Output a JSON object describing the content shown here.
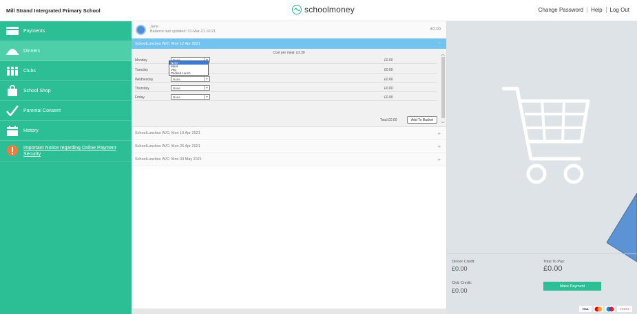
{
  "header": {
    "school_name": "Mill Strand Intergrated Primary School",
    "logo_text": "schoolmoney",
    "links": [
      "Change Password",
      "Help",
      "Log Out"
    ]
  },
  "sidebar": {
    "items": [
      {
        "label": "Payments",
        "icon": "card-icon"
      },
      {
        "label": "Dinners",
        "icon": "dish-icon"
      },
      {
        "label": "Clubs",
        "icon": "people-icon"
      },
      {
        "label": "School Shop",
        "icon": "bag-icon"
      },
      {
        "label": "Parental Consent",
        "icon": "check-icon"
      },
      {
        "label": "History",
        "icon": "calendar-icon"
      },
      {
        "label": "Important Notice regarding Online Payment Security",
        "icon": "alert-icon"
      }
    ]
  },
  "account": {
    "name": "Jane",
    "balance_note": "Balance last updated: 31-Mar-21 10:21",
    "balance": "£0.00"
  },
  "current_week": {
    "title": "SchoolLunches W/C: Mon 12 Apr 2021",
    "cost_per_meal": "Cost per meal: £2.30",
    "days": [
      {
        "name": "Monday",
        "choice": "None",
        "price": "£0.00"
      },
      {
        "name": "Tuesday",
        "choice": "None",
        "price": "£0.00"
      },
      {
        "name": "Wednesday",
        "choice": "None",
        "price": "£0.00"
      },
      {
        "name": "Thursday",
        "choice": "None",
        "price": "£0.00"
      },
      {
        "name": "Friday",
        "choice": "None",
        "price": "£0.00"
      }
    ],
    "dropdown_options": [
      "None",
      "Meat",
      "Veg",
      "Packed Lunch"
    ],
    "total": "Total £0.00",
    "add_button": "Add To Basket"
  },
  "other_weeks": [
    "SchoolLunches W/C: Mon 19 Apr 2021",
    "SchoolLunches W/C: Mon 26 Apr 2021",
    "SchoolLunches W/C: Mon 03 May 2021"
  ],
  "summary": {
    "dinner_credit_label": "Dinner Credit:",
    "dinner_credit": "£0.00",
    "club_credit_label": "Club Credit:",
    "club_credit": "£0.00",
    "total_label": "Total To Pay:",
    "total": "£0.00",
    "pay_button": "Make Payment"
  },
  "payment_logos": [
    "VISA",
    "TRUST"
  ],
  "colors": {
    "brand_green": "#2cbe95",
    "week_blue": "#72c4ee",
    "panel_grey": "#dde3e6"
  }
}
